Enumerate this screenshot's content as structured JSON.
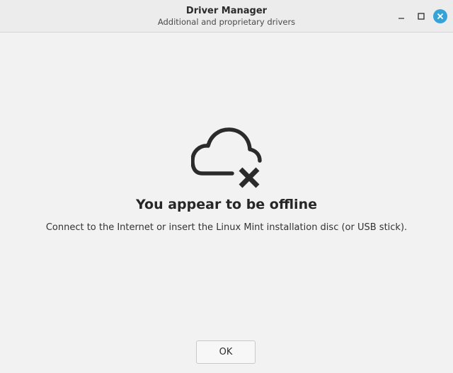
{
  "window": {
    "title": "Driver Manager",
    "subtitle": "Additional and proprietary drivers",
    "controls": {
      "minimize_icon": "minimize-icon",
      "maximize_icon": "maximize-icon",
      "close_icon": "close-icon",
      "close_color": "#35a3d8"
    }
  },
  "main": {
    "icon": "cloud-offline-icon",
    "heading": "You appear to be offline",
    "message": "Connect to the Internet or insert the Linux Mint installation disc (or USB stick).",
    "ok_label": "OK"
  }
}
